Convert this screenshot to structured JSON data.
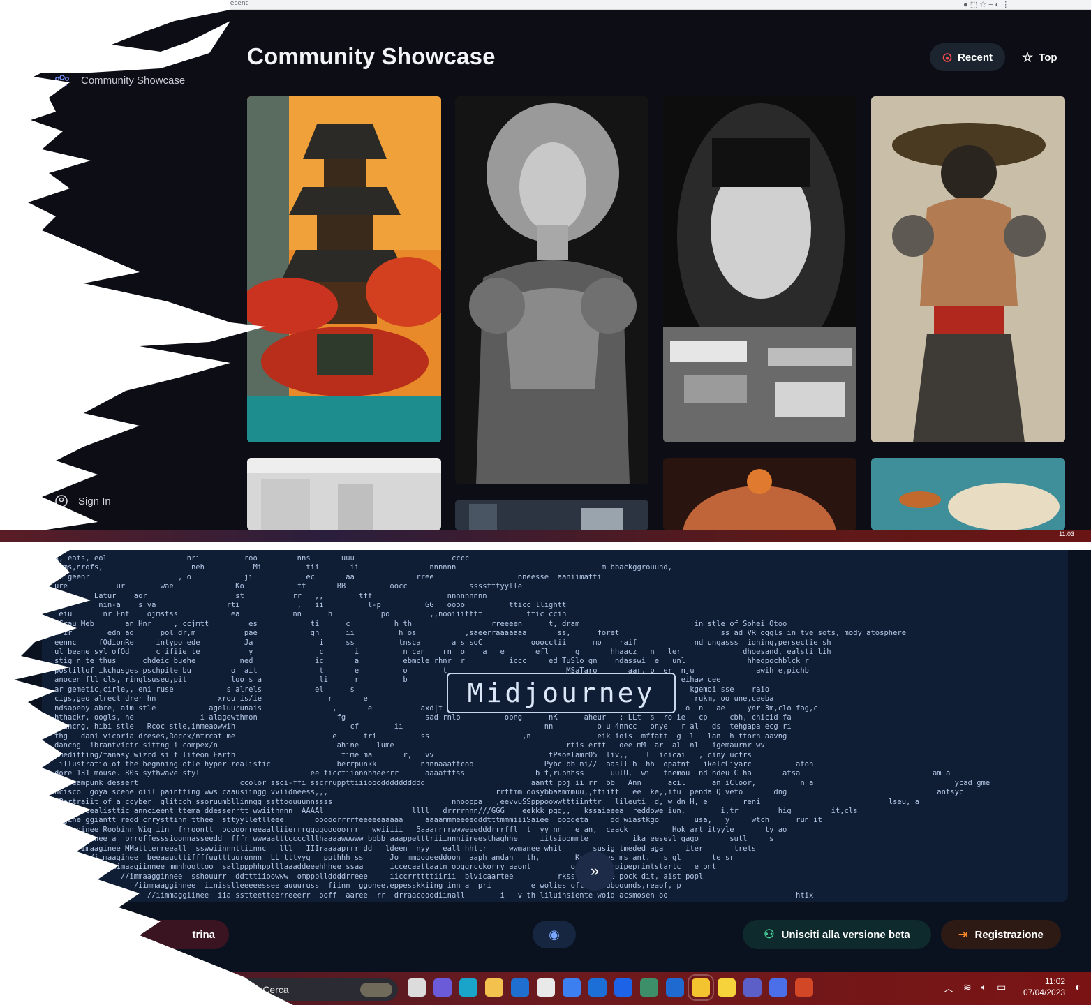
{
  "browser": {
    "url": "om/showcase/recent",
    "controls": "● ⬚ ☆  ≡ ◐ ⋮"
  },
  "sidebar": {
    "items": [
      {
        "label": "Community Showcase",
        "icon": "users-icon"
      }
    ],
    "sign_in": {
      "label": "Sign In",
      "icon": "user-circle-icon"
    }
  },
  "header": {
    "title": "Community Showcase",
    "sort_recent": {
      "label": "Recent",
      "icon": "flame-icon"
    },
    "sort_top": {
      "label": "Top",
      "icon": "star-icon"
    }
  },
  "gallery": {
    "tiles": [
      {
        "subject": "pagoda-autumn"
      },
      {
        "subject": "woman-armor"
      },
      {
        "subject": "newspaper-portrait"
      },
      {
        "subject": "samurai-warrior"
      },
      {
        "subject": "interior-room"
      },
      {
        "subject": "city-street"
      },
      {
        "subject": "knitted-hat"
      },
      {
        "subject": "fish-ocean"
      }
    ]
  },
  "taskbar_top": {
    "time": "11:03"
  },
  "landing": {
    "logo": "Midjourney",
    "ascii_lines": [
      "s, eats, eol                  nri          roo         nns       uuu                      cccc",
      " sms,nrofs,                    neh           Mi          tii       ii                nnnnnn                                 m bbackggrouund,",
      " e geenr                    , o            ji            ec       aa              rree                   nneesse  aaniimatti",
      "ure           ur        wae              Ko            ff       BB          oocc              sssstttyylle",
      "         Latur    aor                    st           rr   ,,        tff                 nnnnnnnnn",
      "          nin-a    s va                rti             ,   ii          l-p          GG   oooo          tticc llightt",
      " eiu       nr Fnt    ojmstss            ea            nn      h           po         ,,nooiiitttt          ttic ccin",
      " Grau Meb       an Hnr     , ccjmtt         es            ti      c          h th                  rreeeen      t, dram                          in stle of Sohei Otoo",
      "n ir        edn ad      pol dr,m           pae            gh      ii          h os           ,saeerraaaaaaa       ss,      foret                       ss ad VR oggls in tve sots, mody atosphere",
      "eennc     fOdionRe     intypo ede          Ja               i     ss          tnsca       a s soC           ooocctii      mo    raif             nd ungasss  ighing,persectie sh",
      "ul beane syl ofOd      c ifiie te           y               c       i          n can    rn  o    a   e       efl      g       hhaacz   n   ler              dhoesand, ealsti lih",
      "stig n te thus      chdeic buehe          ned              ic       a          ebmcle rhnr  r          iccc     ed TuSlo gn    ndasswi  e   unl              hhedpochblck r",
      "postillof ikchusges pschpite bu         o  ait              t       e          o        t                           MSaTaro       aar, o  er  nju              awih e,pichb",
      "anocen fll cls, ringlsuseu,pit          loo s a             li      r          b                              rd    osba  ve  an              eihaw cee",
      "ar gemetic,cirle,, eni ruse            s alrels            el      s                                         urde 4  krthr   o  oi              kgemoi sse    raio",
      "cigs,geo alrect drer hn              xrou is/ie               r       e                                      asdnr /  ppooU  s   to              rukm, oo une,ceeba",
      "ndsapeby abre, aim stle            ageluurunais                ,       e           axd|t ,         ,nno     n      i        bsneT     ee bz    o  n   ae     yer 3m,clo fag,c",
      "hthackr, oogls, ne               i alagewthmon                  fg                  sad rnlo          opng      nK      aheur   ; LLt  s  ro ie   cp     cbh, chicid fa",
      " dancng, hibi stle   Rcoc stle,inmeaowwih                          cf        ii                                nn          o u 4nncc   onye   r al   ds  tehgapa ecg ri",
      "thg   dani vicoria dreses,Roccx/ntrcat me                      e      tri          ss                     ,n               eik iois  mffatt  g  l   lan  h ttorn aavng",
      "dancng  ibrantvictr sittng i compex/n                           ahine    lume                                       rtis ertt   oee mM  ar  al  nl   igemaurnr wv",
      " meditting/fanasy wizrd si f lifeon Earth                        time ma       r,   vv                          tPsoelamr05  liv,,    l  icicai   , ciny uctrs",
      " illustratio of the begnning ofle hyper realistic               berrpunkk          nnnnaaattcoo                Pybc bb ni//  aasll b  hh  opatnt   ikelcCiyarc          aton",
      "dore 131 mouse. 80s sythwave styl                         ee ficctiionnhheerrr      aaaatttss                b t,rubhhss      uulU,  wi   tnemou  nd ndeu C ha       atsa                              am a",
      "f steampunk dessert                       ccolor ssci-ffi sscrruppttiiiooodddddddddd                        aantt ppj ii rr  bb   Ann      acil      an iCloor,          n a                                ycad gme",
      "ncisco  goya scene oiil paintting wws caausiingg vviidneess,,,                                      rrttmm oosybbaammmuu,,ttiitt   ee  ke,,ifu  penda Q veto       dng                                  antsyc",
      " Portraiit of a ccyber  glitcch ssoruumbllinngg ssttoouuunnssss                           nnooppa   ,eevvuSSpppoowwtttiinttr   lileuti  d, w dn H, e        reni                             lseu, a",
      "ine a reealisttic anncieent ttema ddesserrtt wwiithnnn  AAAAl                    llll   drrrrnnn///GGG    eekkk pgg,,   kssaieeea  reddowe iun,        i,tr         hig         it,cls",
      "aggine ggiantt redd crrysttinn tthee  sttyylletlleee       ooooorrrrfeeeeeaaaaa     aaaammmeeeedddtttmmmiiiSaiee  ooodeta     dd wiastkgo        usa,   y     wtch      run it",
      "/imaaginee Roobinn Wig iin  frroontt  ooooorreeaalliierrrggggooooorrr   wwiiiii   5aaarrrrwwweeedddrrrffl  t  yy nn   e an,  caack          Hok art ityyle       ty ao",
      " /immagiinee a  prroffesssioonnasseedd  fffr wwwaatttcccclllhaaaawwwww bbbb aaappetttriiinnniireesthaghhe     iitsioommte          ika eesevl gago       sutl     s",
      "    //imaaginee MMattterreeall  sswwiinnnttiinnc   lll   IIIraaaaprrr dd   ldeen  nyy   eall hhttr     wwmanee whit       susig tmeded aga     iter       trets",
      "        /iimaaginee  beeaauuttiffffuutttuuronnn  LL tttyyg   ppthhh ss      Jo  mmoooeeddoon  aaph andan   th,        Katsngins ms ant.   s gl       te sr",
      "           //iimaagiinnee mmhhoottoo  sallppphhpplllaaaddeeehhhee ssaa      iccecaattaatn ooggrcckorry aaont         of dhaantapipeprintstartc   e ont",
      "               //immaagginnee  sshouurr  ddtttiioowww  ompppllddddrreee     iiccrrttttiirii  blvicaartee          rkss an a foe pock dit, aist popl",
      "                  /iimmaagginnee  iinisslleeeeessee auuuruss  fiinn  ggonee,eppesskkiing inn a  pri         e wolies oft stoodboounds,reaof, p",
      "                     //iimmaggiinee  iia sstteetteerreeerr  ooff  aaree  rr  drraacooodiinall        i   v th liluinsiente woid acsmosen oo                             htix"
    ],
    "scroll_hint_icon": "chevron-double-down-icon",
    "btn_vetrina": "trina",
    "btn_eye_icon": "eye-icon",
    "btn_beta": "Unisciti alla versione beta",
    "btn_registrazione": "Registrazione"
  },
  "taskbar": {
    "search_label": "Cerca",
    "time": "11:02",
    "date": "07/04/2023",
    "apps": [
      {
        "name": "file-explorer-icon",
        "color": "#dcdcdc"
      },
      {
        "name": "chat-icon",
        "color": "#6b5bd8"
      },
      {
        "name": "edge-icon",
        "color": "#1aa4c9"
      },
      {
        "name": "folder-icon",
        "color": "#f2c14e"
      },
      {
        "name": "outlook-icon",
        "color": "#1f6fd1"
      },
      {
        "name": "store-icon",
        "color": "#e9e9e9"
      },
      {
        "name": "copilot-icon",
        "color": "#3b7ff0"
      },
      {
        "name": "mail-icon",
        "color": "#1d6fd8"
      },
      {
        "name": "dropbox-icon",
        "color": "#1c63e8"
      },
      {
        "name": "globe-icon",
        "color": "#3d8f6a"
      },
      {
        "name": "whiteboard-icon",
        "color": "#1e6ad0"
      },
      {
        "name": "chrome-icon",
        "color": "#f4c430"
      },
      {
        "name": "paint-icon",
        "color": "#f6d23b"
      },
      {
        "name": "teams-icon",
        "color": "#5b5fc7"
      },
      {
        "name": "infinity-icon",
        "color": "#4a6fe8"
      },
      {
        "name": "powerpoint-icon",
        "color": "#d24726"
      }
    ],
    "tray": [
      "^",
      "wifi-icon",
      "speaker-icon",
      "battery-icon"
    ]
  }
}
